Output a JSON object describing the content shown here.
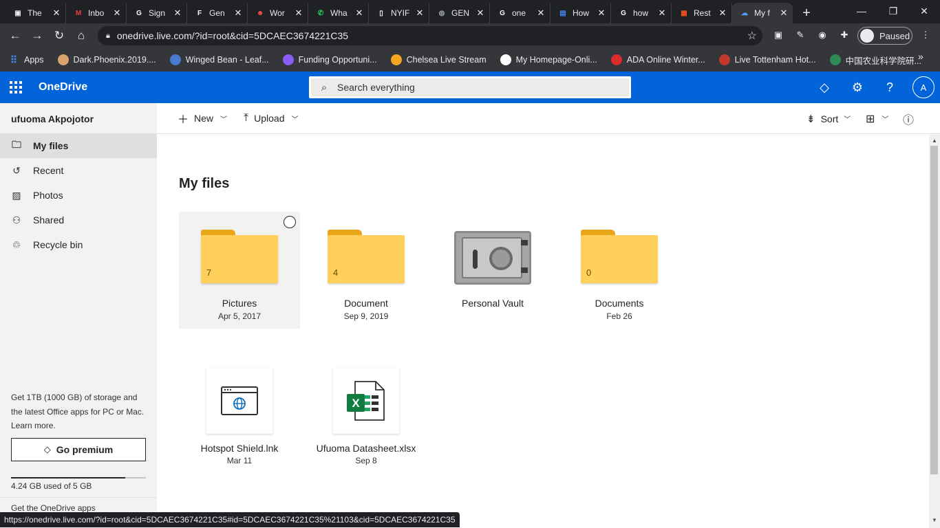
{
  "browser": {
    "tabs": [
      {
        "title": "The",
        "icon": "document-icon",
        "color": "#e8eaed",
        "glyph": "▣"
      },
      {
        "title": "Inbo",
        "icon": "gmail-icon",
        "color": "#ea4335",
        "glyph": "M"
      },
      {
        "title": "Sign",
        "icon": "google-icon",
        "color": "#ffffff",
        "glyph": "G"
      },
      {
        "title": "Gen",
        "icon": "generic-site-icon",
        "color": "#ffffff",
        "glyph": "F"
      },
      {
        "title": "Wor",
        "icon": "face-icon",
        "color": "#ff4b4b",
        "glyph": "☻"
      },
      {
        "title": "Wha",
        "icon": "whatsapp-icon",
        "color": "#25d366",
        "glyph": "✆"
      },
      {
        "title": "NYIF",
        "icon": "page-icon",
        "color": "#ffffff",
        "glyph": "▯"
      },
      {
        "title": "GEN",
        "icon": "globe-icon",
        "color": "#9aa0a6",
        "glyph": "◍"
      },
      {
        "title": "one",
        "icon": "google-icon",
        "color": "#ffffff",
        "glyph": "G"
      },
      {
        "title": "How",
        "icon": "docs-icon",
        "color": "#4285f4",
        "glyph": "▤"
      },
      {
        "title": "how",
        "icon": "google-icon",
        "color": "#ffffff",
        "glyph": "G"
      },
      {
        "title": "Rest",
        "icon": "microsoft-icon",
        "color": "#f25022",
        "glyph": "▦"
      },
      {
        "title": "My f",
        "icon": "onedrive-icon",
        "color": "#4da3ff",
        "glyph": "☁",
        "active": true
      }
    ],
    "url": "onedrive.live.com/?id=root&cid=5DCAEC3674221C35",
    "profile_label": "Paused",
    "bookmarks": [
      {
        "label": "Apps",
        "icon": "apps-grid-icon",
        "color": "#4285f4"
      },
      {
        "label": "Dark.Phoenix.2019....",
        "icon": "bookmark-site-icon",
        "color": "#d9a46b"
      },
      {
        "label": "Winged Bean - Leaf...",
        "icon": "bookmark-site-icon",
        "color": "#4a7bd0"
      },
      {
        "label": "Funding Opportuni...",
        "icon": "bookmark-site-icon",
        "color": "#8a5cf5"
      },
      {
        "label": "Chelsea Live Stream",
        "icon": "bookmark-site-icon",
        "color": "#f4a623"
      },
      {
        "label": "My Homepage-Onli...",
        "icon": "bookmark-site-icon",
        "color": "#ffffff"
      },
      {
        "label": "ADA Online Winter...",
        "icon": "bookmark-site-icon",
        "color": "#d92b2b"
      },
      {
        "label": "Live Tottenham Hot...",
        "icon": "bookmark-site-icon",
        "color": "#c0392b"
      },
      {
        "label": "中国农业科学院研...",
        "icon": "bookmark-site-icon",
        "color": "#2e8b57"
      }
    ],
    "status_url": "https://onedrive.live.com/?id=root&cid=5DCAEC3674221C35#id=5DCAEC3674221C35%21103&cid=5DCAEC3674221C35"
  },
  "header": {
    "brand": "OneDrive",
    "search_placeholder": "Search everything",
    "account_initial": "A",
    "accent": "#0364d9"
  },
  "sidebar": {
    "user_name": "ufuoma Akpojotor",
    "items": [
      {
        "label": "My files",
        "icon": "folder-icon",
        "selected": true
      },
      {
        "label": "Recent",
        "icon": "history-icon"
      },
      {
        "label": "Photos",
        "icon": "photo-icon"
      },
      {
        "label": "Shared",
        "icon": "people-icon"
      },
      {
        "label": "Recycle bin",
        "icon": "recycle-bin-icon"
      }
    ],
    "promo_text": "Get 1TB (1000 GB) of storage and the latest Office apps for PC or Mac.",
    "learn_more": "Learn more.",
    "premium_label": "Go premium",
    "quota_text": "4.24 GB used of 5 GB",
    "quota_fraction": 0.848,
    "get_apps": "Get the OneDrive apps"
  },
  "commands": {
    "new_label": "New",
    "upload_label": "Upload",
    "sort_label": "Sort"
  },
  "main": {
    "title": "My files",
    "folders": [
      {
        "name": "Pictures",
        "date": "Apr 5, 2017",
        "count": "7",
        "selected": true
      },
      {
        "name": "Document",
        "date": "Sep 9, 2019",
        "count": "4"
      },
      {
        "name": "Personal Vault",
        "date": "",
        "vault": true
      },
      {
        "name": "Documents",
        "date": "Feb 26",
        "count": "0"
      }
    ],
    "files": [
      {
        "name": "Hotspot Shield.lnk",
        "date": "Mar 11",
        "icon": "web-shortcut-icon"
      },
      {
        "name": "Ufuoma Datasheet.xlsx",
        "date": "Sep 8",
        "icon": "excel-icon"
      }
    ]
  }
}
